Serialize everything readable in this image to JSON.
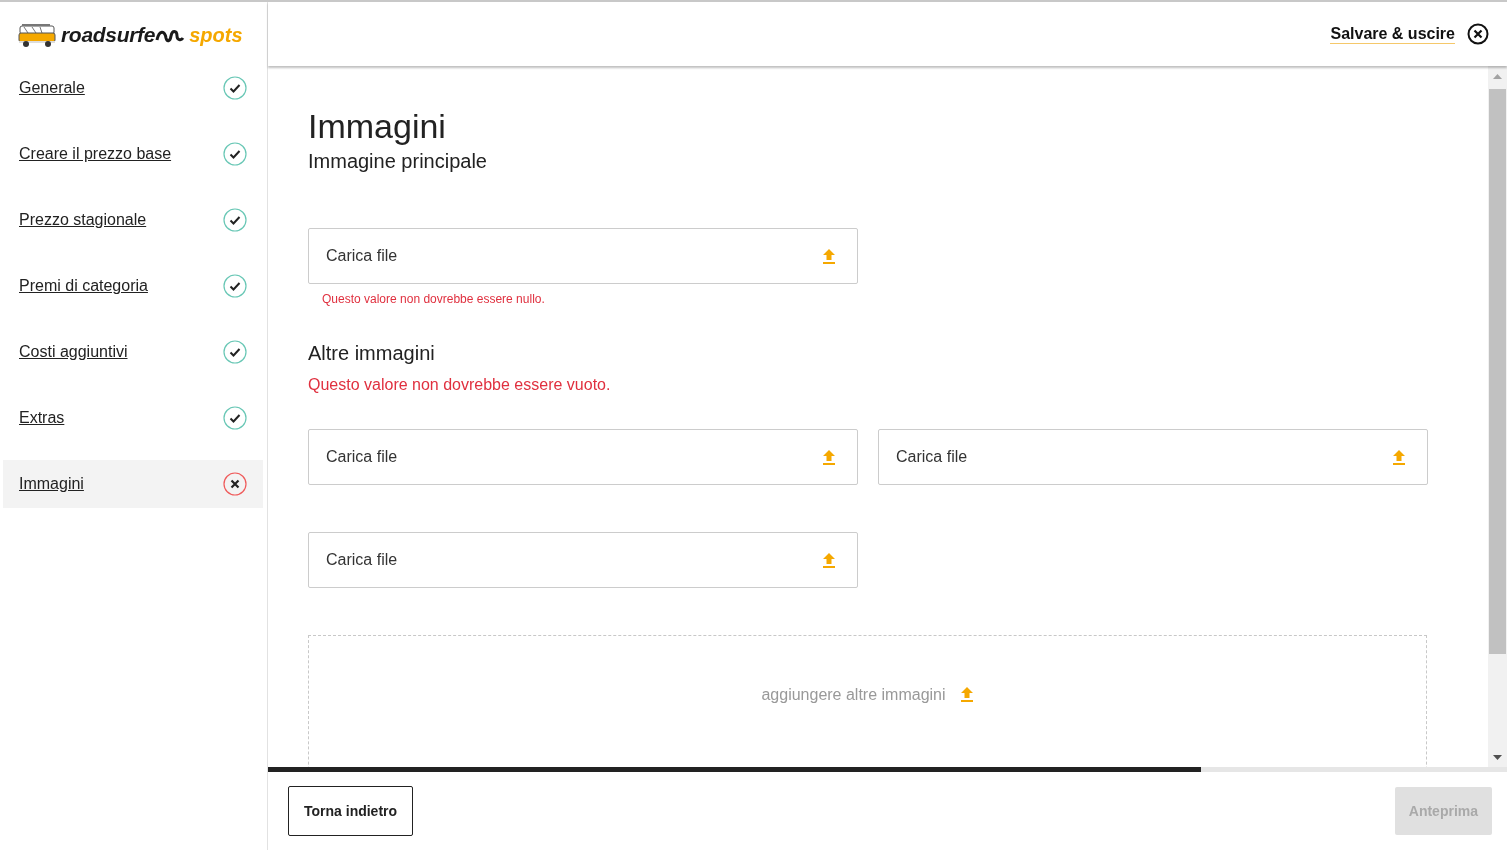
{
  "logo": {
    "brand": "roadsurfe",
    "product": "spots"
  },
  "header": {
    "save_exit": "Salvare & uscire"
  },
  "sidebar": {
    "items": [
      {
        "label": "Generale",
        "complete": true,
        "selected": false
      },
      {
        "label": "Creare il prezzo base",
        "complete": true,
        "selected": false
      },
      {
        "label": "Prezzo stagionale",
        "complete": true,
        "selected": false
      },
      {
        "label": "Premi di categoria",
        "complete": true,
        "selected": false
      },
      {
        "label": "Costi aggiuntivi",
        "complete": true,
        "selected": false
      },
      {
        "label": "Extras",
        "complete": true,
        "selected": false
      },
      {
        "label": "Immagini",
        "complete": false,
        "selected": true
      }
    ]
  },
  "page": {
    "title": "Immagini",
    "sections": [
      {
        "heading": "Immagine principale",
        "uploads": [
          {
            "label": "Carica file"
          }
        ],
        "error": {
          "kind": "field",
          "text": "Questo valore non dovrebbe essere nullo."
        }
      },
      {
        "heading": "Altre immagini",
        "uploads": [
          {
            "label": "Carica file"
          },
          {
            "label": "Carica file"
          },
          {
            "label": "Carica file"
          }
        ],
        "error": {
          "kind": "section",
          "text": "Questo valore non dovrebbe essere vuoto."
        }
      }
    ],
    "dropzone": {
      "label": "aggiungere altre immagini"
    }
  },
  "progress": {
    "level": 0.753
  },
  "footer": {
    "back": "Torna indietro",
    "preview": {
      "label": "Anteprima",
      "disabled": true
    }
  }
}
